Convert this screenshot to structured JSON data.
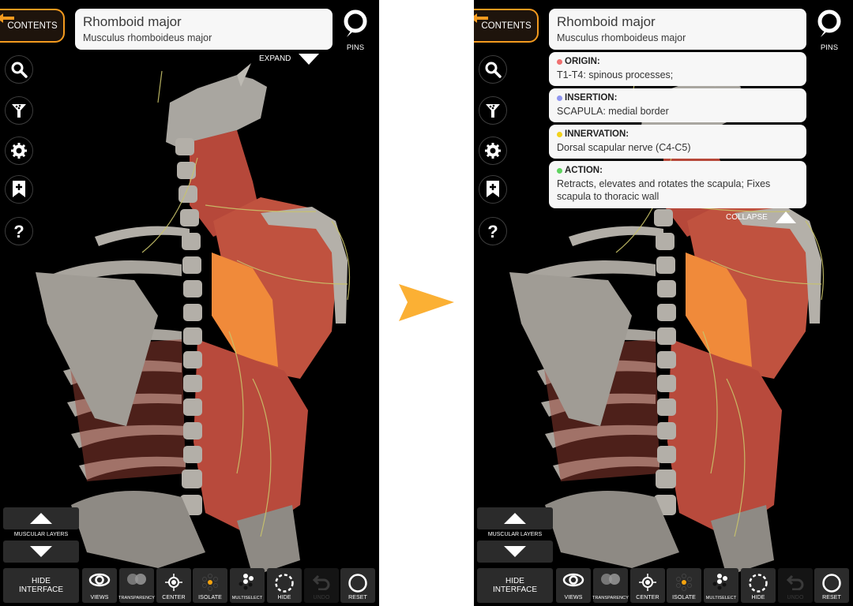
{
  "transition": {
    "arrow_color": "#fbb034"
  },
  "colors": {
    "accent": "#f39a1e",
    "origin": "#f07070",
    "insertion": "#8f95ef",
    "innervation": "#f2d21c",
    "action": "#5fd35f",
    "highlight_muscle": "#f0883a"
  },
  "screens": [
    {
      "state": "collapsed",
      "contents_label": "CONTENTS",
      "title": "Rhomboid major",
      "subtitle": "Musculus rhomboideus major",
      "pins_label": "PINS",
      "toggle_label": "EXPAND",
      "side_tools": [
        "search-icon",
        "filter-icon",
        "gear-icon",
        "bookmark-add-icon",
        "help-icon"
      ],
      "layers_label": "MUSCULAR LAYERS",
      "hide_interface_label": "HIDE INTERFACE",
      "toolbar": [
        {
          "label": "VIEWS",
          "icon": "eye-icon",
          "enabled": true
        },
        {
          "label": "TRANSPARENCY",
          "icon": "transparency-icon",
          "enabled": true
        },
        {
          "label": "CENTER",
          "icon": "center-target-icon",
          "enabled": true
        },
        {
          "label": "ISOLATE",
          "icon": "isolate-icon",
          "enabled": true
        },
        {
          "label": "MULTISELECT",
          "icon": "multiselect-icon",
          "enabled": true
        },
        {
          "label": "HIDE",
          "icon": "hide-dashed-circle-icon",
          "enabled": true
        },
        {
          "label": "UNDO",
          "icon": "undo-icon",
          "enabled": false
        },
        {
          "label": "RESET",
          "icon": "reset-circle-icon",
          "enabled": true
        }
      ]
    },
    {
      "state": "expanded",
      "contents_label": "CONTENTS",
      "title": "Rhomboid major",
      "subtitle": "Musculus rhomboideus major",
      "pins_label": "PINS",
      "toggle_label": "COLLAPSE",
      "info": [
        {
          "heading": "ORIGIN:",
          "text": "T1-T4: spinous processes;"
        },
        {
          "heading": "INSERTION:",
          "text": "SCAPULA: medial border"
        },
        {
          "heading": "INNERVATION:",
          "text": "Dorsal scapular nerve (C4-C5)"
        },
        {
          "heading": "ACTION:",
          "text": "Retracts, elevates and rotates the scapula; Fixes scapula to thoracic wall"
        }
      ],
      "layers_label": "MUSCULAR LAYERS",
      "hide_interface_label": "HIDE INTERFACE",
      "toolbar": [
        {
          "label": "VIEWS"
        },
        {
          "label": "TRANSPARENCY"
        },
        {
          "label": "CENTER"
        },
        {
          "label": "ISOLATE"
        },
        {
          "label": "MULTISELECT"
        },
        {
          "label": "HIDE"
        },
        {
          "label": "UNDO"
        },
        {
          "label": "RESET"
        }
      ]
    }
  ]
}
